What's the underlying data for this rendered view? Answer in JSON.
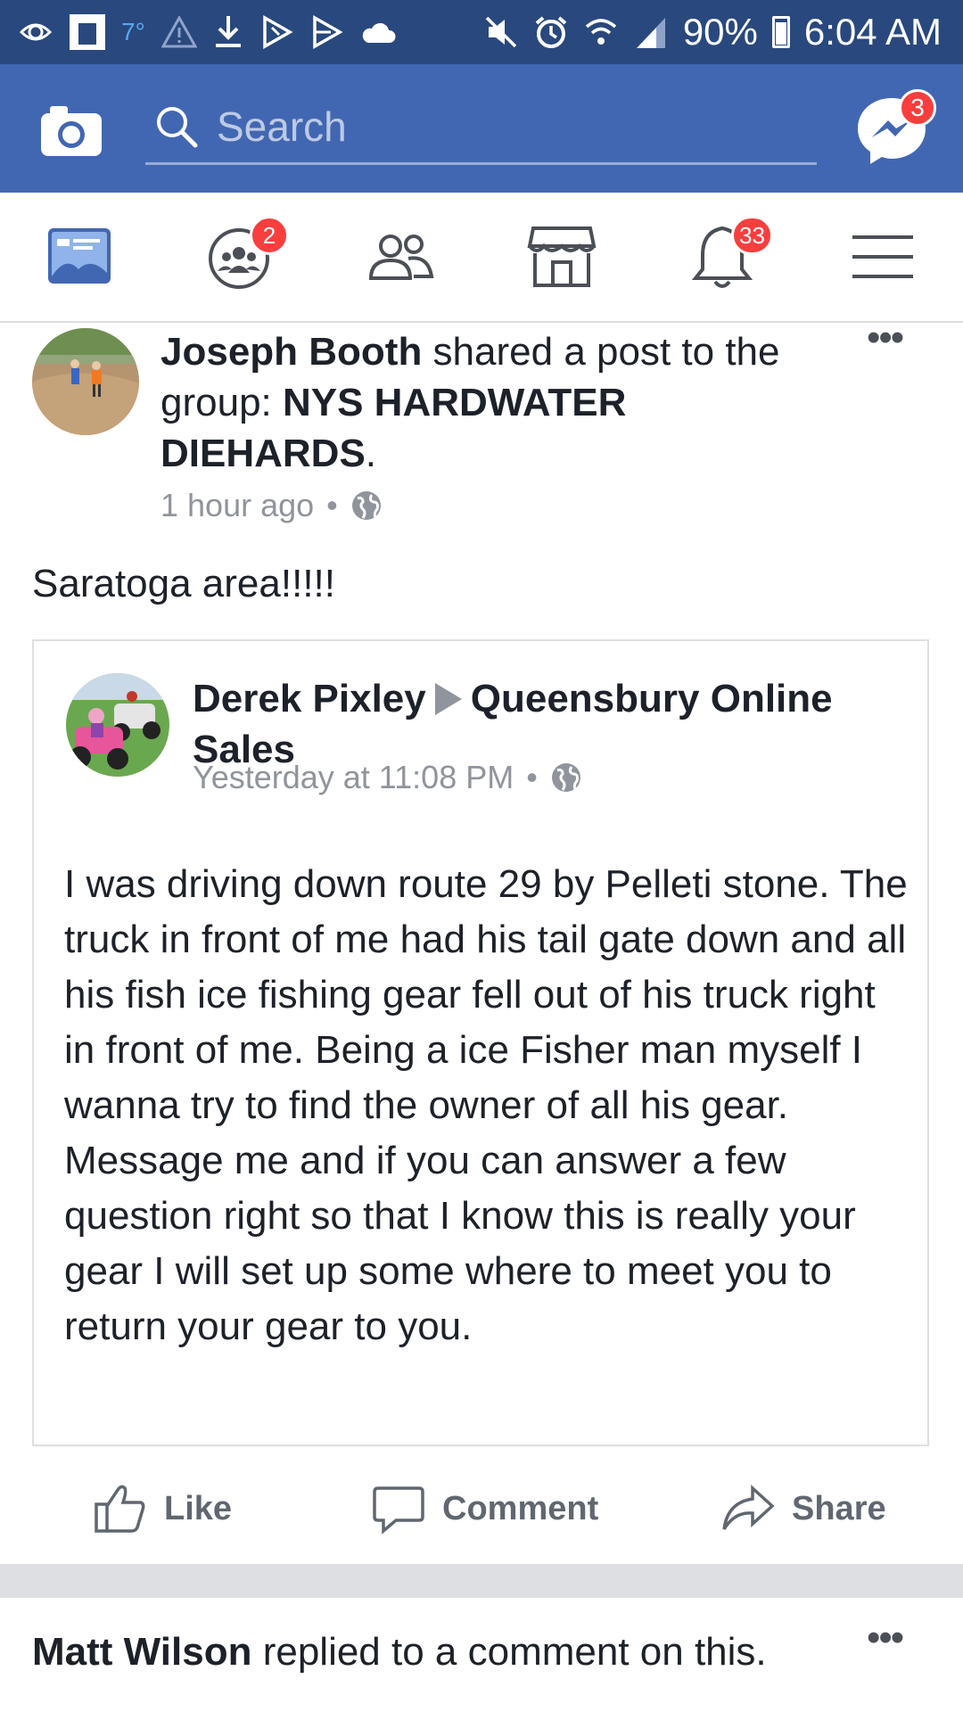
{
  "status_bar": {
    "temperature": "7°",
    "battery": "90%",
    "time": "6:04 AM"
  },
  "top_bar": {
    "search_placeholder": "Search",
    "messenger_badge": "3"
  },
  "nav": {
    "items": [
      {
        "name": "news-feed",
        "badge": ""
      },
      {
        "name": "groups",
        "badge": "2"
      },
      {
        "name": "friends",
        "badge": ""
      },
      {
        "name": "marketplace",
        "badge": ""
      },
      {
        "name": "notifications",
        "badge": "33"
      },
      {
        "name": "menu",
        "badge": ""
      }
    ]
  },
  "post": {
    "author": "Joseph Booth",
    "action_text": " shared a post to the group: ",
    "group": "NYS HARDWATER DIEHARDS",
    "period": ".",
    "time": "1 hour ago",
    "separator": "•",
    "text": "Saratoga area!!!!!",
    "shared": {
      "author": "Derek Pixley",
      "group": "Queensbury Online Sales",
      "time": "Yesterday at 11:08 PM",
      "separator": "•",
      "body": "I was driving down route 29 by Pelleti stone. The truck in front of me had his tail gate down and all his fish ice fishing gear fell out of his truck right in front of me. Being a ice Fisher man myself I wanna try to find the owner of all his gear. Message me and if you can answer a few question right so that I know this is really your gear I will set up some where to meet you to return your gear to you."
    },
    "actions": {
      "like": "Like",
      "comment": "Comment",
      "share": "Share"
    }
  },
  "next_story": {
    "author": "Matt Wilson",
    "text": " replied to a comment on this."
  },
  "colors": {
    "status_bar": "#29487d",
    "top_bar": "#4267b2",
    "badge": "#fa3e3e",
    "nav_active": "#4267b2",
    "muted_text": "#90949c"
  }
}
